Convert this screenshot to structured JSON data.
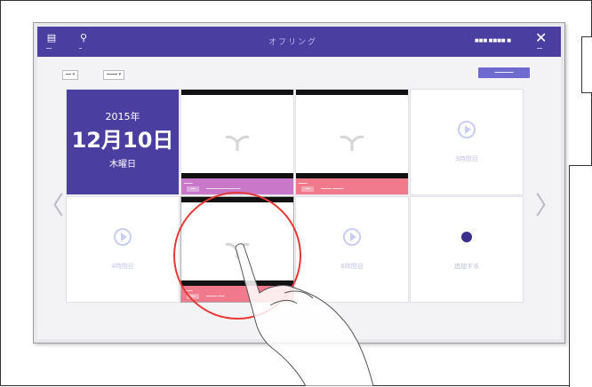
{
  "app": {
    "title": "オフリング",
    "header_icons": [
      {
        "name": "document-icon",
        "glyph": "▤",
        "label": "━━"
      },
      {
        "name": "search-icon",
        "glyph": "⚲",
        "label": "━"
      }
    ],
    "user_label": "■■■ ■■■■ ■",
    "close_glyph": "✕",
    "close_label": "━━"
  },
  "toolbar": {
    "select_1": "━━ ▾",
    "select_2": "━━━━ ▾",
    "button_label": "━━━━━━━"
  },
  "calendar": {
    "year": "2015年",
    "month_day": "12月10日",
    "weekday": "木曜日"
  },
  "tiles": {
    "lesson_1": {
      "tag": "━━━━",
      "chip": "━━",
      "text": "━━━━━━━━━━━━━━━━",
      "color": "#c877c9"
    },
    "lesson_2": {
      "tag": "━━━━",
      "chip": "━━",
      "text": "━━━━━ ━━━━━",
      "color": "#f07a8c"
    },
    "lesson_3": {
      "tag": "━━━━",
      "chip": "━━",
      "text": "━━━━━ ━━━",
      "color": "#f07a8c"
    },
    "period_3": "3時間目",
    "period_4": "4時間目",
    "period_6": "6時間目",
    "add": "追加する"
  },
  "nav": {
    "left": "〈",
    "right": "〉"
  },
  "colors": {
    "header": "#4a3fa0",
    "accent": "#6e6ad0",
    "highlight": "#e53935"
  }
}
